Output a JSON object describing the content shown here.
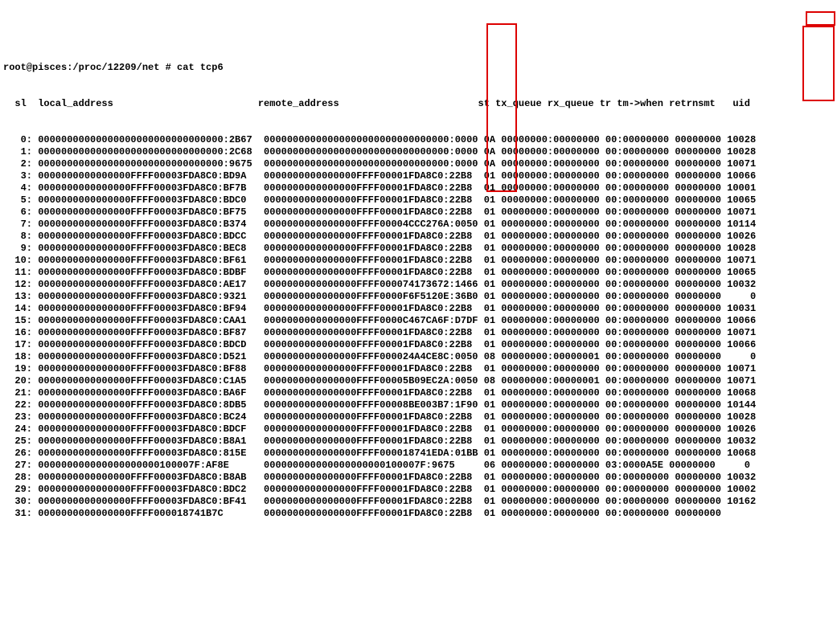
{
  "prompt": "root@pisces:/proc/12209/net # cat tcp6",
  "header": "  sl  local_address                         remote_address                        st tx_queue rx_queue tr tm->when retrnsmt   uid",
  "rows": [
    {
      "sl": "0",
      "la": "00000000000000000000000000000000:2B67",
      "ra": "00000000000000000000000000000000:0000",
      "st": "0A",
      "tx": "00000000:00000000",
      "tr": "00:00000000",
      "rt": "00000000",
      "uid": "10028"
    },
    {
      "sl": "1",
      "la": "00000000000000000000000000000000:2C68",
      "ra": "00000000000000000000000000000000:0000",
      "st": "0A",
      "tx": "00000000:00000000",
      "tr": "00:00000000",
      "rt": "00000000",
      "uid": "10028"
    },
    {
      "sl": "2",
      "la": "00000000000000000000000000000000:9675",
      "ra": "00000000000000000000000000000000:0000",
      "st": "0A",
      "tx": "00000000:00000000",
      "tr": "00:00000000",
      "rt": "00000000",
      "uid": "10071"
    },
    {
      "sl": "3",
      "la": "0000000000000000FFFF00003FDA8C0:BD9A",
      "ra": "0000000000000000FFFF00001FDA8C0:22B8",
      "st": "01",
      "tx": "00000000:00000000",
      "tr": "00:00000000",
      "rt": "00000000",
      "uid": "10066"
    },
    {
      "sl": "4",
      "la": "0000000000000000FFFF00003FDA8C0:BF7B",
      "ra": "0000000000000000FFFF00001FDA8C0:22B8",
      "st": "01",
      "tx": "00000000:00000000",
      "tr": "00:00000000",
      "rt": "00000000",
      "uid": "10001"
    },
    {
      "sl": "5",
      "la": "0000000000000000FFFF00003FDA8C0:BDC0",
      "ra": "0000000000000000FFFF00001FDA8C0:22B8",
      "st": "01",
      "tx": "00000000:00000000",
      "tr": "00:00000000",
      "rt": "00000000",
      "uid": "10065"
    },
    {
      "sl": "6",
      "la": "0000000000000000FFFF00003FDA8C0:BF75",
      "ra": "0000000000000000FFFF00001FDA8C0:22B8",
      "st": "01",
      "tx": "00000000:00000000",
      "tr": "00:00000000",
      "rt": "00000000",
      "uid": "10071"
    },
    {
      "sl": "7",
      "la": "0000000000000000FFFF00003FDA8C0:B374",
      "ra": "0000000000000000FFFF00004CCC276A:0050",
      "st": "01",
      "tx": "00000000:00000000",
      "tr": "00:00000000",
      "rt": "00000000",
      "uid": "10114"
    },
    {
      "sl": "8",
      "la": "0000000000000000FFFF00003FDA8C0:BDCC",
      "ra": "0000000000000000FFFF00001FDA8C0:22B8",
      "st": "01",
      "tx": "00000000:00000000",
      "tr": "00:00000000",
      "rt": "00000000",
      "uid": "10026"
    },
    {
      "sl": "9",
      "la": "0000000000000000FFFF00003FDA8C0:BEC8",
      "ra": "0000000000000000FFFF00001FDA8C0:22B8",
      "st": "01",
      "tx": "00000000:00000000",
      "tr": "00:00000000",
      "rt": "00000000",
      "uid": "10028"
    },
    {
      "sl": "10",
      "la": "0000000000000000FFFF00003FDA8C0:BF61",
      "ra": "0000000000000000FFFF00001FDA8C0:22B8",
      "st": "01",
      "tx": "00000000:00000000",
      "tr": "00:00000000",
      "rt": "00000000",
      "uid": "10071"
    },
    {
      "sl": "11",
      "la": "0000000000000000FFFF00003FDA8C0:BDBF",
      "ra": "0000000000000000FFFF00001FDA8C0:22B8",
      "st": "01",
      "tx": "00000000:00000000",
      "tr": "00:00000000",
      "rt": "00000000",
      "uid": "10065"
    },
    {
      "sl": "12",
      "la": "0000000000000000FFFF00003FDA8C0:AE17",
      "ra": "0000000000000000FFFF000074173672:1466",
      "st": "01",
      "tx": "00000000:00000000",
      "tr": "00:00000000",
      "rt": "00000000",
      "uid": "10032"
    },
    {
      "sl": "13",
      "la": "0000000000000000FFFF00003FDA8C0:9321",
      "ra": "0000000000000000FFFF0000F6F5120E:36B0",
      "st": "01",
      "tx": "00000000:00000000",
      "tr": "00:00000000",
      "rt": "00000000",
      "uid": "    0"
    },
    {
      "sl": "14",
      "la": "0000000000000000FFFF00003FDA8C0:BF94",
      "ra": "0000000000000000FFFF00001FDA8C0:22B8",
      "st": "01",
      "tx": "00000000:00000000",
      "tr": "00:00000000",
      "rt": "00000000",
      "uid": "10031"
    },
    {
      "sl": "15",
      "la": "0000000000000000FFFF00003FDA8C0:CAA1",
      "ra": "0000000000000000FFFF0000C467CA6F:D7DF",
      "st": "01",
      "tx": "00000000:00000000",
      "tr": "00:00000000",
      "rt": "00000000",
      "uid": "10066"
    },
    {
      "sl": "16",
      "la": "0000000000000000FFFF00003FDA8C0:BF87",
      "ra": "0000000000000000FFFF00001FDA8C0:22B8",
      "st": "01",
      "tx": "00000000:00000000",
      "tr": "00:00000000",
      "rt": "00000000",
      "uid": "10071"
    },
    {
      "sl": "17",
      "la": "0000000000000000FFFF00003FDA8C0:BDCD",
      "ra": "0000000000000000FFFF00001FDA8C0:22B8",
      "st": "01",
      "tx": "00000000:00000000",
      "tr": "00:00000000",
      "rt": "00000000",
      "uid": "10066"
    },
    {
      "sl": "18",
      "la": "0000000000000000FFFF00003FDA8C0:D521",
      "ra": "0000000000000000FFFF000024A4CE8C:0050",
      "st": "08",
      "tx": "00000000:00000001",
      "tr": "00:00000000",
      "rt": "00000000",
      "uid": "    0"
    },
    {
      "sl": "19",
      "la": "0000000000000000FFFF00003FDA8C0:BF88",
      "ra": "0000000000000000FFFF00001FDA8C0:22B8",
      "st": "01",
      "tx": "00000000:00000000",
      "tr": "00:00000000",
      "rt": "00000000",
      "uid": "10071"
    },
    {
      "sl": "20",
      "la": "0000000000000000FFFF00003FDA8C0:C1A5",
      "ra": "0000000000000000FFFF00005B09EC2A:0050",
      "st": "08",
      "tx": "00000000:00000001",
      "tr": "00:00000000",
      "rt": "00000000",
      "uid": "10071"
    },
    {
      "sl": "21",
      "la": "0000000000000000FFFF00003FDA8C0:BA6F",
      "ra": "0000000000000000FFFF00001FDA8C0:22B8",
      "st": "01",
      "tx": "00000000:00000000",
      "tr": "00:00000000",
      "rt": "00000000",
      "uid": "10068"
    },
    {
      "sl": "22",
      "la": "0000000000000000FFFF00003FDA8C0:8DB5",
      "ra": "0000000000000000FFFF00008BE003B7:1F90",
      "st": "01",
      "tx": "00000000:00000000",
      "tr": "00:00000000",
      "rt": "00000000",
      "uid": "10144"
    },
    {
      "sl": "23",
      "la": "0000000000000000FFFF00003FDA8C0:BC24",
      "ra": "0000000000000000FFFF00001FDA8C0:22B8",
      "st": "01",
      "tx": "00000000:00000000",
      "tr": "00:00000000",
      "rt": "00000000",
      "uid": "10028"
    },
    {
      "sl": "24",
      "la": "0000000000000000FFFF00003FDA8C0:BDCF",
      "ra": "0000000000000000FFFF00001FDA8C0:22B8",
      "st": "01",
      "tx": "00000000:00000000",
      "tr": "00:00000000",
      "rt": "00000000",
      "uid": "10026"
    },
    {
      "sl": "25",
      "la": "0000000000000000FFFF00003FDA8C0:B8A1",
      "ra": "0000000000000000FFFF00001FDA8C0:22B8",
      "st": "01",
      "tx": "00000000:00000000",
      "tr": "00:00000000",
      "rt": "00000000",
      "uid": "10032"
    },
    {
      "sl": "26",
      "la": "0000000000000000FFFF00003FDA8C0:815E",
      "ra": "0000000000000000FFFF000018741EDA:01BB",
      "st": "01",
      "tx": "00000000:00000000",
      "tr": "00:00000000",
      "rt": "00000000",
      "uid": "10068"
    },
    {
      "sl": "27",
      "la": "000000000000000000000100007F:AF8E",
      "ra": "000000000000000000000100007F:9675",
      "st": "06",
      "tx": "00000000:00000000",
      "tr": "03:0000A5E",
      "rt": "00000000",
      "uid": "    0"
    },
    {
      "sl": "28",
      "la": "0000000000000000FFFF00003FDA8C0:B8AB",
      "ra": "0000000000000000FFFF00001FDA8C0:22B8",
      "st": "01",
      "tx": "00000000:00000000",
      "tr": "00:00000000",
      "rt": "00000000",
      "uid": "10032"
    },
    {
      "sl": "29",
      "la": "0000000000000000FFFF00003FDA8C0:BDC2",
      "ra": "0000000000000000FFFF00001FDA8C0:22B8",
      "st": "01",
      "tx": "00000000:00000000",
      "tr": "00:00000000",
      "rt": "00000000",
      "uid": "10002"
    },
    {
      "sl": "30",
      "la": "0000000000000000FFFF00003FDA8C0:BF41",
      "ra": "0000000000000000FFFF00001FDA8C0:22B8",
      "st": "01",
      "tx": "00000000:00000000",
      "tr": "00:00000000",
      "rt": "00000000",
      "uid": "10162"
    },
    {
      "sl": "31",
      "la": "0000000000000000FFFF000018741B7C",
      "ra": "0000000000000000FFFF00001FDA8C0:22B8",
      "st": "01",
      "tx": "00000000:00000000",
      "tr": "00:00000000",
      "rt": "00000000",
      "uid": ""
    }
  ]
}
